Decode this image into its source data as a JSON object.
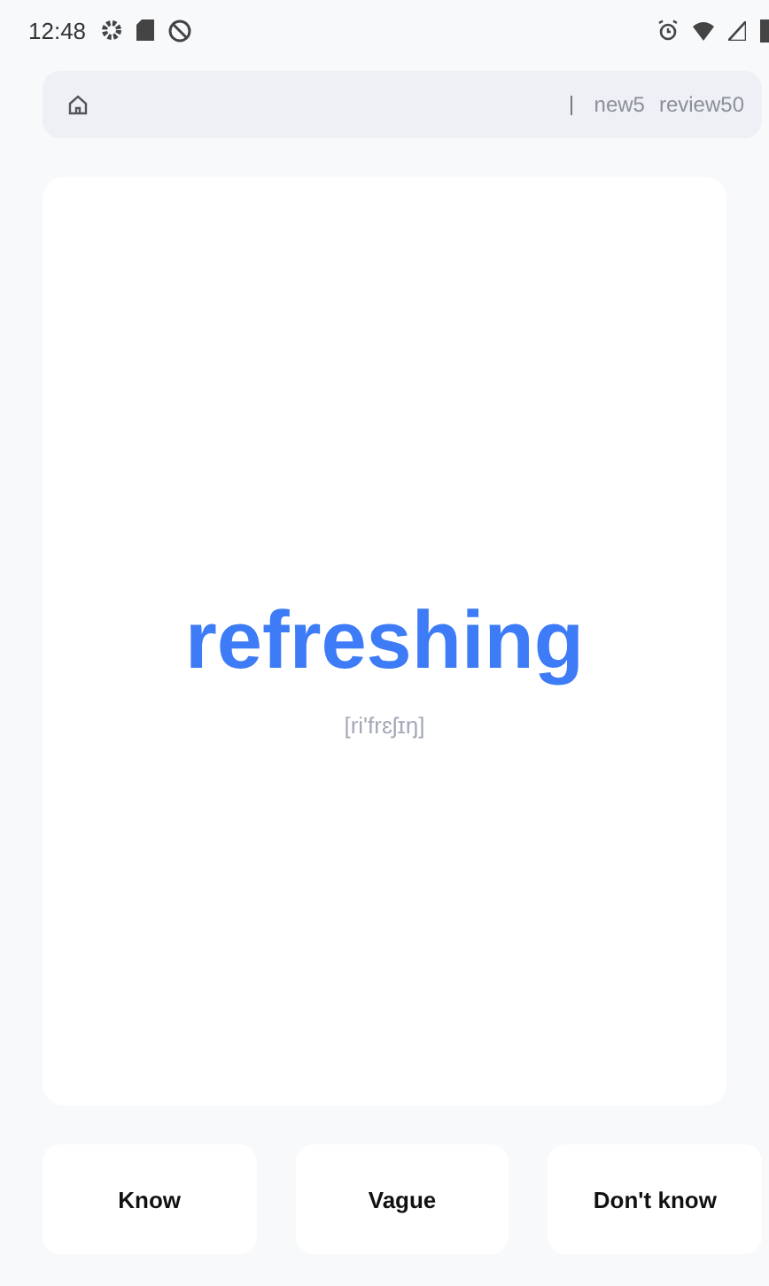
{
  "status_bar": {
    "time": "12:48"
  },
  "top_bar": {
    "new_count": "new5",
    "review_count": "review50"
  },
  "card": {
    "word": "refreshing",
    "phonetic": "[ri'frɛʃɪŋ]"
  },
  "buttons": [
    {
      "label": "Know"
    },
    {
      "label": "Vague"
    },
    {
      "label": "Don't know"
    }
  ]
}
